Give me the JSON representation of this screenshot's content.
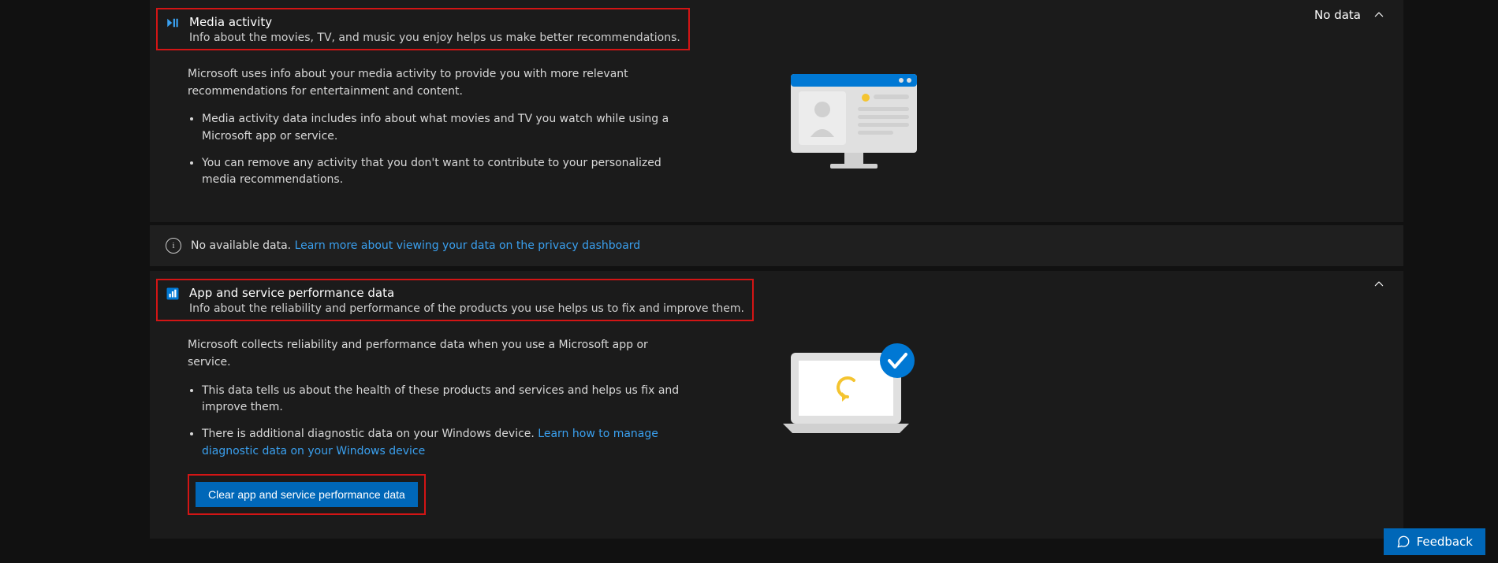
{
  "media": {
    "title": "Media activity",
    "subtitle": "Info about the movies, TV, and music you enjoy helps us make better recommendations.",
    "status": "No data",
    "intro": "Microsoft uses info about your media activity to provide you with more relevant recommendations for entertainment and content.",
    "bullet1": "Media activity data includes info about what movies and TV you watch while using a Microsoft app or service.",
    "bullet2": "You can remove any activity that you don't want to contribute to your personalized media recommendations."
  },
  "notice": {
    "text": "No available data.",
    "link": "Learn more about viewing your data on the privacy dashboard"
  },
  "perf": {
    "title": "App and service performance data",
    "subtitle": "Info about the reliability and performance of the products you use helps us to fix and improve them.",
    "intro": "Microsoft collects reliability and performance data when you use a Microsoft app or service.",
    "bullet1": "This data tells us about the health of these products and services and helps us fix and improve them.",
    "bullet2_a": "There is additional diagnostic data on your Windows device. ",
    "bullet2_link": "Learn how to manage diagnostic data on your Windows device",
    "clear_btn": "Clear app and service performance data"
  },
  "feedback": "Feedback"
}
